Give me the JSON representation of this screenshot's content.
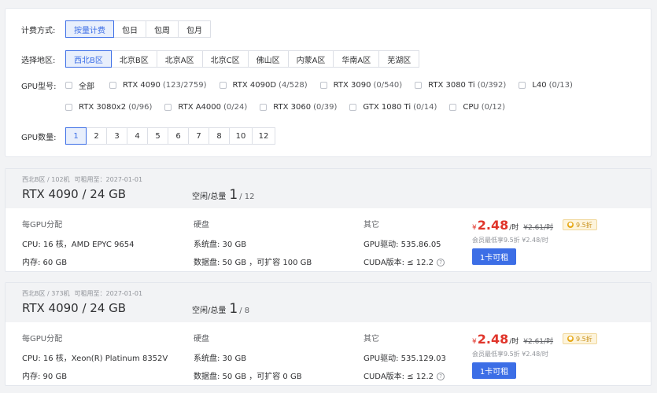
{
  "filters": {
    "billing": {
      "label": "计费方式:",
      "options": [
        "按量计费",
        "包日",
        "包周",
        "包月"
      ],
      "active": 0
    },
    "region": {
      "label": "选择地区:",
      "options": [
        "西北B区",
        "北京B区",
        "北京A区",
        "北京C区",
        "佛山区",
        "内蒙A区",
        "华南A区",
        "芜湖区"
      ],
      "active": 0
    },
    "gpu_model": {
      "label": "GPU型号:",
      "row1": [
        {
          "name": "全部",
          "count": ""
        },
        {
          "name": "RTX 4090",
          "count": "(123/2759)"
        },
        {
          "name": "RTX 4090D",
          "count": "(4/528)"
        },
        {
          "name": "RTX 3090",
          "count": "(0/540)"
        },
        {
          "name": "RTX 3080 Ti",
          "count": "(0/392)"
        },
        {
          "name": "L40",
          "count": "(0/13)"
        }
      ],
      "row2": [
        {
          "name": "RTX 3080x2",
          "count": "(0/96)"
        },
        {
          "name": "RTX A4000",
          "count": "(0/24)"
        },
        {
          "name": "RTX 3060",
          "count": "(0/39)"
        },
        {
          "name": "GTX 1080 Ti",
          "count": "(0/14)"
        },
        {
          "name": "CPU",
          "count": "(0/12)"
        }
      ]
    },
    "gpu_count": {
      "label": "GPU数量:",
      "options": [
        "1",
        "2",
        "3",
        "4",
        "5",
        "6",
        "7",
        "8",
        "10",
        "12"
      ],
      "active": 0
    }
  },
  "machines": [
    {
      "region": "西北B区 / 102机",
      "rent_until": "可租用至：2027-01-01",
      "title": "RTX 4090 / 24 GB",
      "idle_label": "空闲/总量",
      "idle": "1",
      "total": "/ 12",
      "spec_header": "每GPU分配",
      "cpu": "CPU:  16 核，AMD EPYC 9654",
      "mem": "内存:  60 GB",
      "disk_header": "硬盘",
      "sys_disk": "系统盘:  30 GB",
      "data_disk": "数据盘:  50 GB ，可扩容 100 GB",
      "other_header": "其它",
      "driver": "GPU驱动:  535.86.05",
      "cuda": "CUDA版本:  ≤ 12.2",
      "price_cur": "¥",
      "price": "2.48",
      "price_unit": "/时",
      "old_price": "¥2.61/时",
      "discount": "9.5折",
      "member": "会员最低享9.5折  ¥2.48/时",
      "rent_button": "1卡可租"
    },
    {
      "region": "西北B区 / 373机",
      "rent_until": "可租用至：2027-01-01",
      "title": "RTX 4090 / 24 GB",
      "idle_label": "空闲/总量",
      "idle": "1",
      "total": "/ 8",
      "spec_header": "每GPU分配",
      "cpu": "CPU:  16 核，Xeon(R) Platinum 8352V",
      "mem": "内存:  90 GB",
      "disk_header": "硬盘",
      "sys_disk": "系统盘:  30 GB",
      "data_disk": "数据盘:  50 GB ，可扩容 0 GB",
      "other_header": "其它",
      "driver": "GPU驱动:  535.129.03",
      "cuda": "CUDA版本:  ≤ 12.2",
      "price_cur": "¥",
      "price": "2.48",
      "price_unit": "/时",
      "old_price": "¥2.61/时",
      "discount": "9.5折",
      "member": "会员最低享9.5折  ¥2.48/时",
      "rent_button": "1卡可租"
    }
  ],
  "colors": {
    "accent": "#3c6ee6",
    "price": "#e0352b",
    "badge_bg": "#fdf4dc"
  }
}
